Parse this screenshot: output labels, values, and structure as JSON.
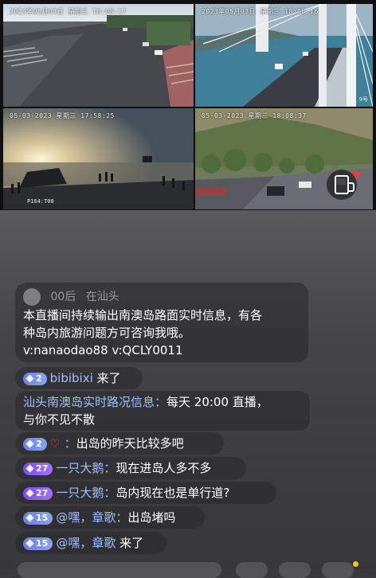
{
  "cameras": [
    {
      "timestamp": "2023年05月03日  星期三  18:08:17"
    },
    {
      "timestamp": "2023年05月03日  星期三  18:08:16",
      "caption": "9号"
    },
    {
      "timestamp": "05-03-2023  星期三  17:58:25",
      "caption": "P164:T00"
    },
    {
      "timestamp": "05-03-2023  星期三  18:08:37"
    }
  ],
  "pinned": {
    "user": "00后",
    "location": "在汕头",
    "text_line1": "本直播间持续输出南澳岛路面实时信息，有各",
    "text_line2": "种岛内旅游问题方可咨询我哦。",
    "text_line3": "v:nanaodao88 v:QCLY0011"
  },
  "messages": [
    {
      "level": "2",
      "name": "bibibixi",
      "text": " 来了"
    },
    {
      "name": "汕头南澳岛实时路况信息：",
      "text": "每天 20:00 直播，",
      "text2": "与你不见不散"
    },
    {
      "level": "2",
      "name": "：",
      "text": "出岛的昨天比较多吧"
    },
    {
      "level": "27",
      "name": "一只大鹅：",
      "text": "现在进岛人多不多"
    },
    {
      "level": "27",
      "name": "一只大鹅：",
      "text": "岛内现在也是单行道?"
    },
    {
      "level": "15",
      "name": "@嘿，章歌：",
      "text": "出岛堵吗"
    },
    {
      "level": "15",
      "name": "@嘿，章歌",
      "text": " 来了"
    }
  ]
}
